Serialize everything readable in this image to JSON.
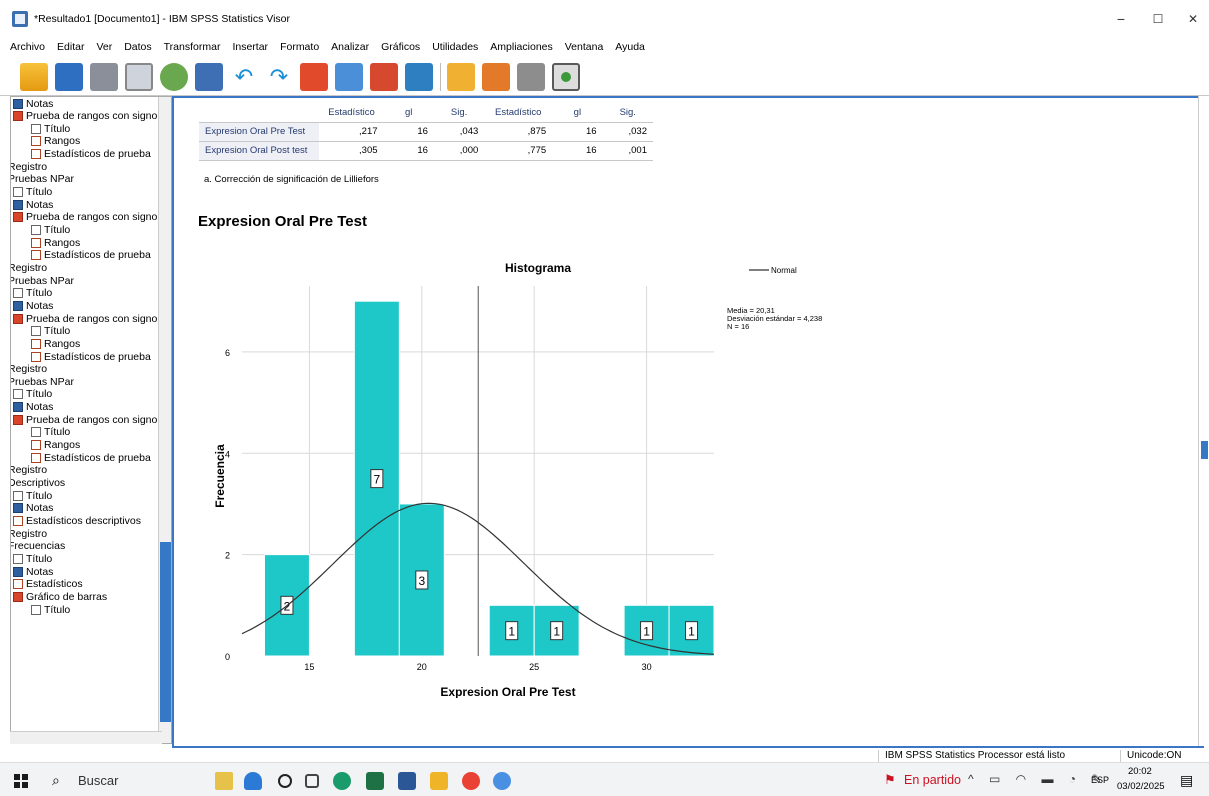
{
  "window": {
    "title": "*Resultado1 [Documento1] - IBM SPSS Statistics Visor",
    "controls": {
      "minimize": "−",
      "maximize": "☐",
      "close": "✕"
    }
  },
  "menu": [
    "Archivo",
    "Editar",
    "Ver",
    "Datos",
    "Transformar",
    "Insertar",
    "Formato",
    "Analizar",
    "Gráficos",
    "Utilidades",
    "Ampliaciones",
    "Ventana",
    "Ayuda"
  ],
  "outline": [
    {
      "label": "Notas",
      "icon": "notes-icon",
      "indent": 1
    },
    {
      "label": "Prueba de rangos con signo",
      "icon": "procedure-icon",
      "indent": 1
    },
    {
      "label": "Título",
      "icon": "title-icon",
      "indent": 2
    },
    {
      "label": "Rangos",
      "icon": "table-icon",
      "indent": 2
    },
    {
      "label": "Estadísticos de prueba",
      "icon": "table-icon",
      "indent": 2
    },
    {
      "label": "Registro",
      "icon": "",
      "indent": 0
    },
    {
      "label": "Pruebas NPar",
      "icon": "",
      "indent": 0
    },
    {
      "label": "Título",
      "icon": "title-icon",
      "indent": 1
    },
    {
      "label": "Notas",
      "icon": "notes-icon",
      "indent": 1
    },
    {
      "label": "Prueba de rangos con signo",
      "icon": "procedure-icon",
      "indent": 1
    },
    {
      "label": "Título",
      "icon": "title-icon",
      "indent": 2
    },
    {
      "label": "Rangos",
      "icon": "table-icon",
      "indent": 2
    },
    {
      "label": "Estadísticos de prueba",
      "icon": "table-icon",
      "indent": 2
    },
    {
      "label": "Registro",
      "icon": "",
      "indent": 0
    },
    {
      "label": "Pruebas NPar",
      "icon": "",
      "indent": 0
    },
    {
      "label": "Título",
      "icon": "title-icon",
      "indent": 1
    },
    {
      "label": "Notas",
      "icon": "notes-icon",
      "indent": 1
    },
    {
      "label": "Prueba de rangos con signo",
      "icon": "procedure-icon",
      "indent": 1
    },
    {
      "label": "Título",
      "icon": "title-icon",
      "indent": 2
    },
    {
      "label": "Rangos",
      "icon": "table-icon",
      "indent": 2
    },
    {
      "label": "Estadísticos de prueba",
      "icon": "table-icon",
      "indent": 2
    },
    {
      "label": "Registro",
      "icon": "",
      "indent": 0
    },
    {
      "label": "Pruebas NPar",
      "icon": "",
      "indent": 0
    },
    {
      "label": "Título",
      "icon": "title-icon",
      "indent": 1
    },
    {
      "label": "Notas",
      "icon": "notes-icon",
      "indent": 1
    },
    {
      "label": "Prueba de rangos con signo",
      "icon": "procedure-icon",
      "indent": 1
    },
    {
      "label": "Título",
      "icon": "title-icon",
      "indent": 2
    },
    {
      "label": "Rangos",
      "icon": "table-icon",
      "indent": 2
    },
    {
      "label": "Estadísticos de prueba",
      "icon": "table-icon",
      "indent": 2
    },
    {
      "label": "Registro",
      "icon": "",
      "indent": 0
    },
    {
      "label": "Descriptivos",
      "icon": "",
      "indent": 0
    },
    {
      "label": "Título",
      "icon": "title-icon",
      "indent": 1
    },
    {
      "label": "Notas",
      "icon": "notes-icon",
      "indent": 1
    },
    {
      "label": "Estadísticos descriptivos",
      "icon": "table-icon",
      "indent": 1
    },
    {
      "label": "Registro",
      "icon": "",
      "indent": 0
    },
    {
      "label": "Frecuencias",
      "icon": "",
      "indent": 0
    },
    {
      "label": "Título",
      "icon": "title-icon",
      "indent": 1
    },
    {
      "label": "Notas",
      "icon": "notes-icon",
      "indent": 1
    },
    {
      "label": "Estadísticos",
      "icon": "table-icon",
      "indent": 1
    },
    {
      "label": "Gráfico de barras",
      "icon": "procedure-icon",
      "indent": 1
    },
    {
      "label": "Título",
      "icon": "title-icon",
      "indent": 2
    }
  ],
  "table": {
    "headers": [
      "Estadístico",
      "gl",
      "Sig.",
      "Estadístico",
      "gl",
      "Sig."
    ],
    "rows": [
      {
        "label": "Expresion Oral  Pre Test",
        "cells": [
          ",217",
          "16",
          ",043",
          ",875",
          "16",
          ",032"
        ]
      },
      {
        "label": "Expresion Oral  Post test",
        "cells": [
          ",305",
          "16",
          ",000",
          ",775",
          "16",
          ",001"
        ]
      }
    ],
    "footnote": "a. Corrección de significación de Lilliefors"
  },
  "heading": "Expresion Oral  Pre Test",
  "chart_data": {
    "type": "bar",
    "title": "Histograma",
    "xlabel": "Expresion Oral  Pre Test",
    "ylabel": "Frecuencia",
    "bins": [
      {
        "from": 13,
        "to": 15,
        "count": 2
      },
      {
        "from": 15,
        "to": 17,
        "count": 0
      },
      {
        "from": 17,
        "to": 19,
        "count": 7
      },
      {
        "from": 19,
        "to": 21,
        "count": 3
      },
      {
        "from": 21,
        "to": 23,
        "count": 0
      },
      {
        "from": 23,
        "to": 25,
        "count": 1
      },
      {
        "from": 25,
        "to": 27,
        "count": 1
      },
      {
        "from": 27,
        "to": 29,
        "count": 0
      },
      {
        "from": 29,
        "to": 31,
        "count": 1
      },
      {
        "from": 31,
        "to": 33,
        "count": 1
      }
    ],
    "xticks": [
      15,
      20,
      25,
      30
    ],
    "yticks": [
      0,
      2,
      4,
      6
    ],
    "xlim": [
      12,
      33
    ],
    "ylim": [
      0,
      7.3
    ],
    "normal": {
      "mean": 20.31,
      "sd": 4.238,
      "n": 16
    },
    "legend": "Normal",
    "stats": [
      "Media = 20,31",
      "Desviación estándar = 4,238",
      "N = 16"
    ],
    "bar_color": "#1ec8c8"
  },
  "status": {
    "processor": "IBM SPSS Statistics Processor está listo",
    "unicode": "Unicode:ON"
  },
  "taskbar": {
    "search": "Buscar",
    "weather": "En partido",
    "lang": "ESP",
    "time": "20:02",
    "date": "03/02/2025"
  }
}
